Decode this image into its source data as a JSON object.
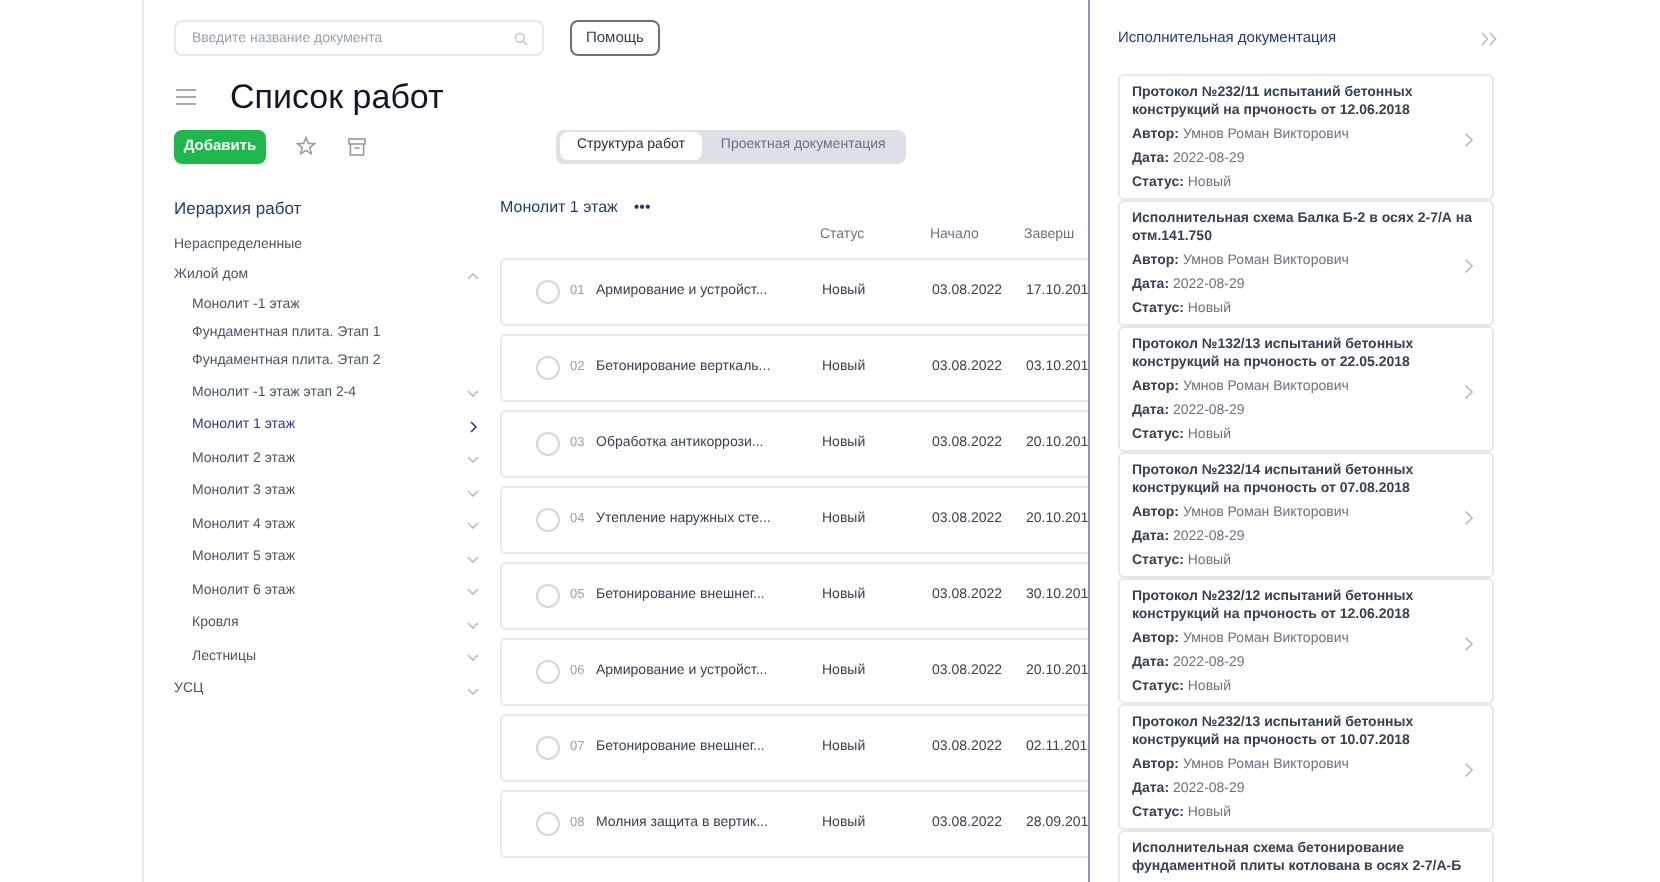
{
  "search": {
    "placeholder": "Введите название документа"
  },
  "help_button": "Помощь",
  "page_title": "Список работ",
  "add_button": "Добавить",
  "view_tabs": [
    {
      "label": "Структура работ",
      "selected": true
    },
    {
      "label": "Проектная документация",
      "selected": false
    }
  ],
  "hierarchy": {
    "title": "Иерархия работ",
    "items": [
      {
        "label": "Нераспределенные",
        "kind": "leaf",
        "selected": false
      },
      {
        "label": "Жилой дом",
        "kind": "group",
        "expanded": true,
        "selected": false,
        "children": [
          {
            "label": "Монолит -1 этаж",
            "kind": "leaf",
            "selected": false
          },
          {
            "label": "Фундаментная плита. Этап 1",
            "kind": "leaf",
            "selected": false
          },
          {
            "label": "Фундаментная плита. Этап 2",
            "kind": "leaf",
            "selected": false
          },
          {
            "label": "Монолит -1 этаж этап 2-4",
            "kind": "group",
            "expanded": false,
            "selected": false
          },
          {
            "label": "Монолит 1 этаж",
            "kind": "group",
            "expanded": false,
            "selected": true
          },
          {
            "label": "Монолит 2 этаж",
            "kind": "group",
            "expanded": false,
            "selected": false
          },
          {
            "label": "Монолит 3 этаж",
            "kind": "group",
            "expanded": false,
            "selected": false
          },
          {
            "label": "Монолит 4 этаж",
            "kind": "group",
            "expanded": false,
            "selected": false
          },
          {
            "label": "Монолит 5 этаж",
            "kind": "group",
            "expanded": false,
            "selected": false
          },
          {
            "label": "Монолит 6 этаж",
            "kind": "group",
            "expanded": false,
            "selected": false
          },
          {
            "label": "Кровля",
            "kind": "group",
            "expanded": false,
            "selected": false
          },
          {
            "label": "Лестницы",
            "kind": "group",
            "expanded": false,
            "selected": false
          }
        ]
      },
      {
        "label": "УСЦ",
        "kind": "group",
        "expanded": false,
        "selected": false
      }
    ]
  },
  "works": {
    "title": "Монолит 1 этаж",
    "more_icon": "•••",
    "columns": [
      "Статус",
      "Начало",
      "Заверш"
    ],
    "rows": [
      {
        "number": "01",
        "selected": false,
        "name": "Армирование и устройст...",
        "status": "Новый",
        "start": "03.08.2022",
        "end": "17.10.201"
      },
      {
        "number": "02",
        "selected": false,
        "name": "Бетонирование верткаль...",
        "status": "Новый",
        "start": "03.08.2022",
        "end": "03.10.201"
      },
      {
        "number": "03",
        "selected": false,
        "name": "Обработка антикоррози...",
        "status": "Новый",
        "start": "03.08.2022",
        "end": "20.10.201"
      },
      {
        "number": "04",
        "selected": false,
        "name": "Утепление наружных сте...",
        "status": "Новый",
        "start": "03.08.2022",
        "end": "20.10.201"
      },
      {
        "number": "05",
        "selected": false,
        "name": "Бетонирование внешнег...",
        "status": "Новый",
        "start": "03.08.2022",
        "end": "30.10.201"
      },
      {
        "number": "06",
        "selected": false,
        "name": "Армирование и устройст...",
        "status": "Новый",
        "start": "03.08.2022",
        "end": "20.10.201"
      },
      {
        "number": "07",
        "selected": false,
        "name": "Бетонирование внешнег...",
        "status": "Новый",
        "start": "03.08.2022",
        "end": "02.11.201"
      },
      {
        "number": "08",
        "selected": false,
        "name": "Молния защита в вертик...",
        "status": "Новый",
        "start": "03.08.2022",
        "end": "28.09.201"
      }
    ]
  },
  "docs_panel": {
    "title": "Исполнительная документация",
    "cards": [
      {
        "title": "Протокол №232/11 испытаний бетонных конструкций на прчоность от 12.06.2018",
        "author_label": "Автор:",
        "author": "Умнов Роман Викторович",
        "date_label": "Дата:",
        "date": "2022-08-29",
        "status_label": "Статус:",
        "status": "Новый"
      },
      {
        "title": "Исполнительная схема Балка Б-2 в осях 2-7/А на отм.141.750",
        "author_label": "Автор:",
        "author": "Умнов Роман Викторович",
        "date_label": "Дата:",
        "date": "2022-08-29",
        "status_label": "Статус:",
        "status": "Новый"
      },
      {
        "title": "Протокол №132/13 испытаний бетонных конструкций на прчоность от 22.05.2018",
        "author_label": "Автор:",
        "author": "Умнов Роман Викторович",
        "date_label": "Дата:",
        "date": "2022-08-29",
        "status_label": "Статус:",
        "status": "Новый"
      },
      {
        "title": "Протокол №232/14 испытаний бетонных конструкций на прчоность от 07.08.2018",
        "author_label": "Автор:",
        "author": "Умнов Роман Викторович",
        "date_label": "Дата:",
        "date": "2022-08-29",
        "status_label": "Статус:",
        "status": "Новый"
      },
      {
        "title": "Протокол №232/12 испытаний бетонных конструкций на прчоность от 12.06.2018",
        "author_label": "Автор:",
        "author": "Умнов Роман Викторович",
        "date_label": "Дата:",
        "date": "2022-08-29",
        "status_label": "Статус:",
        "status": "Новый"
      },
      {
        "title": "Протокол №232/13 испытаний бетонных конструкций на прчоность от 10.07.2018",
        "author_label": "Автор:",
        "author": "Умнов Роман Викторович",
        "date_label": "Дата:",
        "date": "2022-08-29",
        "status_label": "Статус:",
        "status": "Новый"
      },
      {
        "title": "Исполнительная схема бетонирование фундаментной плиты котлована в осях 2-7/А-Б"
      }
    ]
  }
}
